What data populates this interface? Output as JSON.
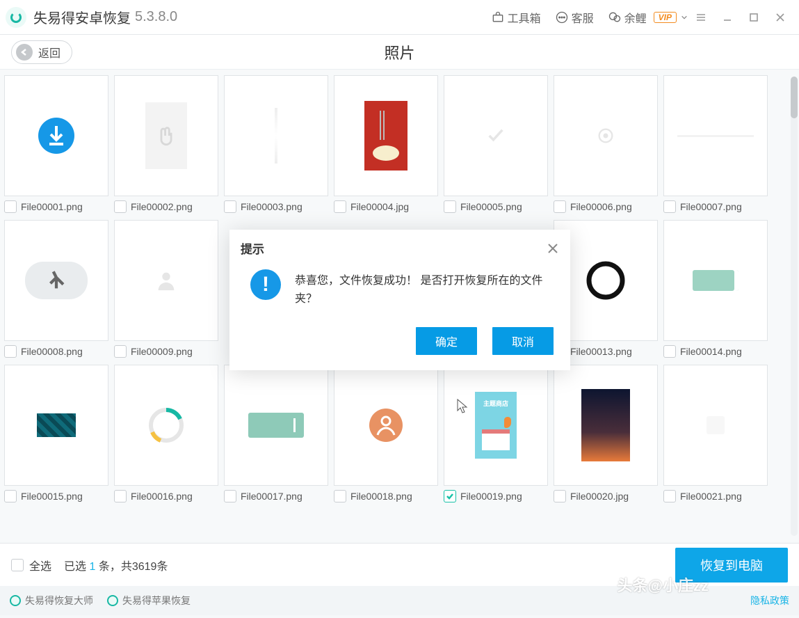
{
  "titlebar": {
    "app_name": "失易得安卓恢复",
    "version": "5.3.8.0",
    "toolbox": "工具箱",
    "service": "客服",
    "username": "余鲤",
    "vip": "VIP"
  },
  "subhead": {
    "back": "返回",
    "title": "照片"
  },
  "files": [
    {
      "name": "File00001.png",
      "checked": false,
      "thumb": "download"
    },
    {
      "name": "File00002.png",
      "checked": false,
      "thumb": "hand"
    },
    {
      "name": "File00003.png",
      "checked": false,
      "thumb": "pencil"
    },
    {
      "name": "File00004.jpg",
      "checked": false,
      "thumb": "noodles"
    },
    {
      "name": "File00005.png",
      "checked": false,
      "thumb": "check"
    },
    {
      "name": "File00006.png",
      "checked": false,
      "thumb": "location"
    },
    {
      "name": "File00007.png",
      "checked": false,
      "thumb": "line"
    },
    {
      "name": "File00008.png",
      "checked": false,
      "thumb": "arrows"
    },
    {
      "name": "File00009.png",
      "checked": false,
      "thumb": "person"
    },
    {
      "name": "",
      "checked": false,
      "thumb": "hidden"
    },
    {
      "name": "",
      "checked": false,
      "thumb": "hidden"
    },
    {
      "name": "",
      "checked": false,
      "thumb": "hidden"
    },
    {
      "name": "File00013.png",
      "checked": false,
      "thumb": "circle"
    },
    {
      "name": "File00014.png",
      "checked": false,
      "thumb": "greenbar"
    },
    {
      "name": "File00015.png",
      "checked": false,
      "thumb": "stripes"
    },
    {
      "name": "File00016.png",
      "checked": false,
      "thumb": "ring"
    },
    {
      "name": "File00017.png",
      "checked": false,
      "thumb": "greenbar2"
    },
    {
      "name": "File00018.png",
      "checked": false,
      "thumb": "avatar"
    },
    {
      "name": "File00019.png",
      "checked": true,
      "thumb": "building"
    },
    {
      "name": "File00020.jpg",
      "checked": false,
      "thumb": "gradient"
    },
    {
      "name": "File00021.png",
      "checked": false,
      "thumb": "blank"
    }
  ],
  "footer": {
    "select_all": "全选",
    "selected_prefix": "已选",
    "selected_count": "1",
    "selected_mid": "条，共",
    "total": "3619",
    "selected_suffix": "条",
    "recover": "恢复到电脑"
  },
  "footer2": {
    "link1": "失易得恢复大师",
    "link2": "失易得苹果恢复",
    "privacy": "隐私政策",
    "watermark": "头条@小庄zz"
  },
  "dialog": {
    "title": "提示",
    "message": "恭喜您，文件恢复成功！ 是否打开恢复所在的文件夹？",
    "ok": "确定",
    "cancel": "取消"
  }
}
